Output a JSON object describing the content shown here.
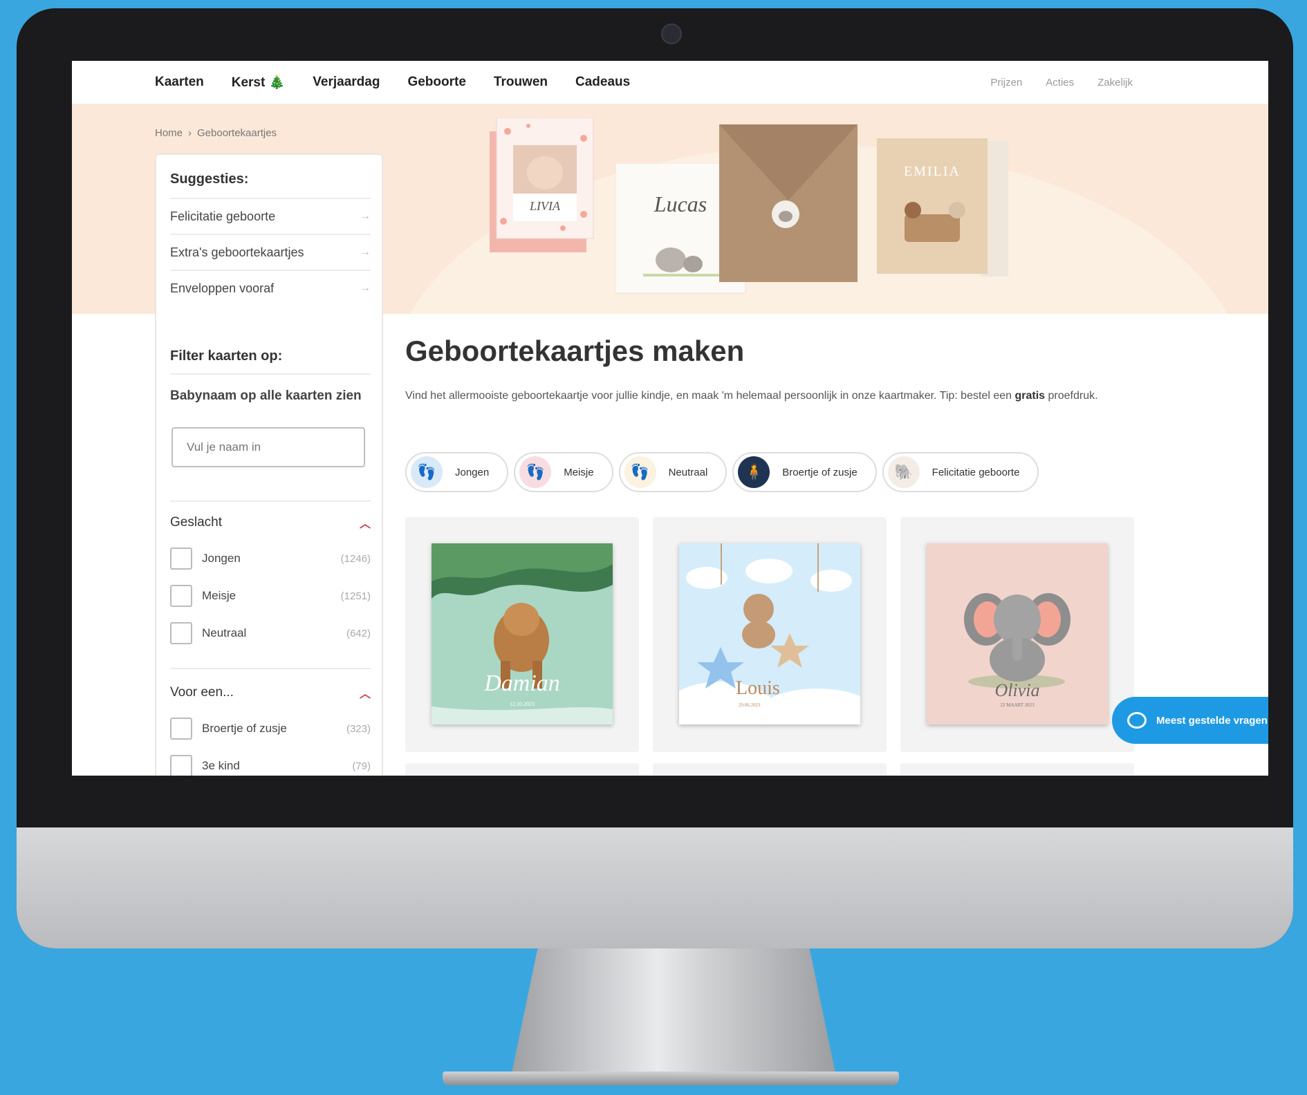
{
  "nav": {
    "items": [
      "Kaarten",
      "Kerst 🎄",
      "Verjaardag",
      "Geboorte",
      "Trouwen",
      "Cadeaus"
    ],
    "right": [
      "Prijzen",
      "Acties",
      "Zakelijk"
    ]
  },
  "breadcrumb": {
    "home": "Home",
    "separator": "›",
    "current": "Geboortekaartjes"
  },
  "hero": {
    "card_names": [
      "LIVIA",
      "Lucas",
      "EMILIA"
    ]
  },
  "sidebar": {
    "suggestions_title": "Suggesties:",
    "suggestions": [
      "Felicitatie geboorte",
      "Extra's geboortekaartjes",
      "Enveloppen vooraf"
    ],
    "filter_title": "Filter kaarten op:",
    "babyname_label": "Babynaam op alle kaarten zien",
    "name_placeholder": "Vul je naam in",
    "gender_group": "Geslacht",
    "gender_options": [
      {
        "label": "Jongen",
        "count": "(1246)"
      },
      {
        "label": "Meisje",
        "count": "(1251)"
      },
      {
        "label": "Neutraal",
        "count": "(642)"
      }
    ],
    "for_group": "Voor een...",
    "for_options": [
      {
        "label": "Broertje of zusje",
        "count": "(323)"
      },
      {
        "label": "3e kind",
        "count": "(79)"
      }
    ]
  },
  "main": {
    "title": "Geboortekaartjes maken",
    "intro_1": "Vind het allermooiste geboortekaartje voor jullie kindje, en maak 'm helemaal persoonlijk in onze kaartmaker. Tip: bestel een",
    "intro_bold": "gratis",
    "intro_2": "proefdruk."
  },
  "chips": [
    "Jongen",
    "Meisje",
    "Neutraal",
    "Broertje of zusje",
    "Felicitatie geboorte"
  ],
  "cards": [
    {
      "name": "Damian",
      "date": "12.10.2023"
    },
    {
      "name": "Louis",
      "date": "29.06.2023"
    },
    {
      "name": "Olivia",
      "date": "23 MAART 2023"
    }
  ],
  "faq": {
    "label": "Meest gestelde vragen"
  },
  "colors": {
    "accent": "#d6334f",
    "faq": "#1e9ae4",
    "hero_bg": "#fbe8d8",
    "backdrop": "#3aa6df"
  }
}
